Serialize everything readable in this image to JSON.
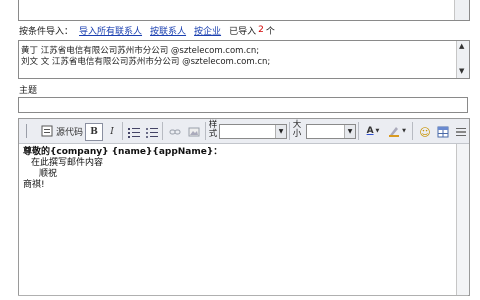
{
  "import_row": {
    "label": "按条件导入：",
    "link_all": "导入所有联系人",
    "link_contact": "按联系人",
    "link_company": "按企业",
    "imported_prefix": "已导入",
    "imported_count": "2",
    "imported_suffix": "个"
  },
  "recipients": [
    "黄丁 江苏省电信有限公司苏州市分公司 @sztelecom.com.cn;",
    "刘文 文 江苏省电信有限公司苏州市分公司 @sztelecom.com.cn;"
  ],
  "subject": {
    "label": "主题",
    "value": ""
  },
  "toolbar": {
    "source_label": "源代码",
    "bold": "B",
    "italic": "I",
    "style_label": "样式",
    "size_label": "大小",
    "font_color_glyph": "A",
    "emoticon": "☺"
  },
  "body": {
    "line1": "尊敬的{company} {name}{appName}：",
    "line2": "在此撰写邮件内容",
    "line3": "顺祝",
    "line4": "商祺!"
  }
}
